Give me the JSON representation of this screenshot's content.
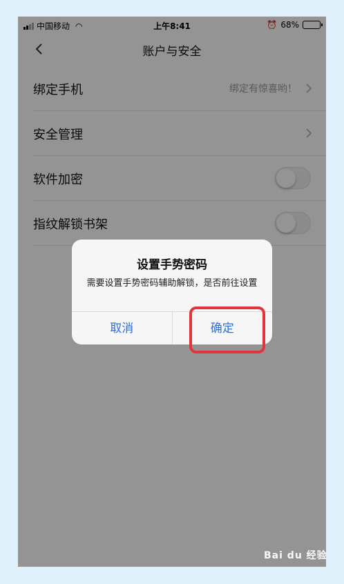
{
  "status_bar": {
    "carrier": "中国移动",
    "time": "上午8:41",
    "battery": "68%",
    "battery_level": 0.68
  },
  "nav": {
    "title": "账户与安全",
    "back_icon": "chevron-left-icon"
  },
  "settings": [
    {
      "label": "绑定手机",
      "detail": "绑定有惊喜哟！",
      "control": "chevron"
    },
    {
      "label": "安全管理",
      "detail": "",
      "control": "chevron"
    },
    {
      "label": "软件加密",
      "control": "toggle",
      "on": false
    },
    {
      "label": "指纹解锁书架",
      "control": "toggle",
      "on": false
    }
  ],
  "dialog": {
    "title": "设置手势密码",
    "message": "需要设置手势密码辅助解锁，是否前往设置",
    "cancel_label": "取消",
    "confirm_label": "确定"
  },
  "colors": {
    "accent": "#2a6fd6",
    "highlight": "#e2353b"
  },
  "watermark": "Bai du 经验"
}
